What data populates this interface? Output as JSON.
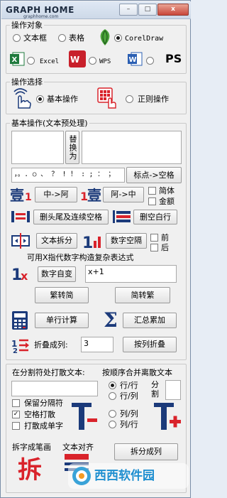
{
  "app": {
    "logo": "GRAPH HOME",
    "logo_sub": "graphhome.com",
    "min_label": "–",
    "max_label": "□",
    "close_label": "x"
  },
  "target": {
    "group_label": "操作对象",
    "textbox": "文本框",
    "table": "表格",
    "coreldraw": "CorelDraw",
    "excel": "Excel",
    "wps": "WPS",
    "word": "",
    "ps": "PS",
    "selected": "CorelDraw"
  },
  "mode": {
    "group_label": "操作选择",
    "basic": "基本操作",
    "regex": "正则操作",
    "selected": "基本操作"
  },
  "basic": {
    "group_label": "基本操作(文本预处理)",
    "replace_btn": "替换为",
    "find_value": "",
    "replace_value": "",
    "punct_value": "，。. ○ 、 ？ ! ！ : ; ： ；",
    "punct_to_space_btn": "标点->空格",
    "zh_to_ar_btn": "中->阿",
    "ar_to_zh_btn": "阿->中",
    "simplified_label": "简体",
    "amount_label": "金额",
    "trim_spaces_btn": "删头尾及连续空格",
    "delete_blank_lines_btn": "删空白行",
    "split_text_btn": "文本拆分",
    "num_space_btn": "数字空隔",
    "before_label": "前",
    "after_label": "后",
    "expr_caption": "可用X指代数字构造复杂表达式",
    "num_increment_btn": "数字自变",
    "expr_value": "x+1",
    "trad_to_simp_btn": "繁转简",
    "simp_to_trad_btn": "简转繁",
    "single_line_calc_btn": "单行计算",
    "sum_btn": "汇总累加",
    "fold_label": "折叠成列:",
    "fold_value": "3",
    "fold_by_list_btn": "按列折叠"
  },
  "split": {
    "split_caption": "在分割符处打散文本:",
    "split_value": "",
    "keep_sep_label": "保留分隔符",
    "keep_sep_checked": false,
    "space_scatter_label": "空格打散",
    "space_scatter_checked": true,
    "scatter_single_label": "打散成单字",
    "scatter_single_checked": false,
    "merge_caption": "按顺序合并离散文本",
    "row_row_label": "行/行",
    "row_col_label": "行/列",
    "col_col_label": "列/列",
    "col_row_label": "列/行",
    "merge_selected": "行/行",
    "divider_label": "分割",
    "divider_value": "",
    "split_strokes_label": "拆字成笔画",
    "text_align_label": "文本对齐",
    "split_to_cols_btn": "拆分成列"
  },
  "watermark": {
    "text": "西西软件园"
  },
  "colors": {
    "title_bg": "#cdd9e8",
    "window_bg": "#f0f0f0",
    "icon_red": "#d9232b",
    "icon_blue": "#1f4e9c",
    "icon_navy": "#1b3a7a",
    "excel_green": "#1e7a3c",
    "word_blue": "#2b5fb3",
    "wps_red": "#c8202b"
  }
}
